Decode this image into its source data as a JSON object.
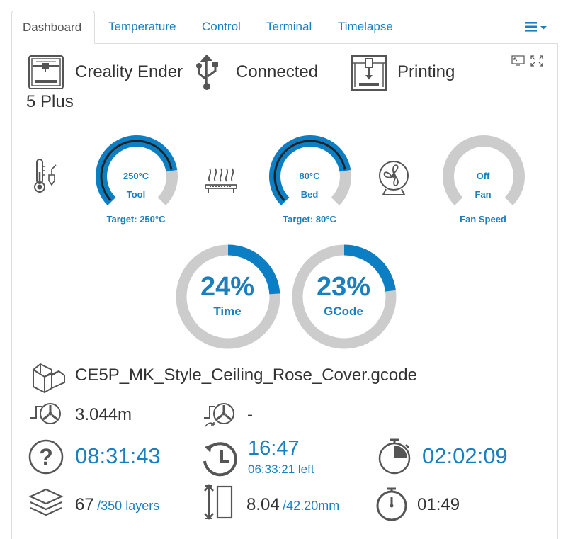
{
  "tabs": [
    {
      "label": "Dashboard",
      "active": true
    },
    {
      "label": "Temperature"
    },
    {
      "label": "Control"
    },
    {
      "label": "Terminal"
    },
    {
      "label": "Timelapse"
    }
  ],
  "printer": {
    "name": "Creality Ender 5 Plus",
    "name_line1": "Creality Ender",
    "name_line2": "5 Plus",
    "connection": "Connected",
    "state": "Printing"
  },
  "gauges": {
    "tool": {
      "value": "250°C",
      "label": "Tool",
      "target": "Target: 250°C",
      "fraction": 1.0
    },
    "bed": {
      "value": "80°C",
      "label": "Bed",
      "target": "Target: 80°C",
      "fraction": 1.0
    },
    "fan": {
      "value": "Off",
      "label": "Fan",
      "target": "Fan Speed",
      "fraction": 0.0
    }
  },
  "progress": {
    "time": {
      "value": "24%",
      "label": "Time",
      "fraction": 0.24
    },
    "gcode": {
      "value": "23%",
      "label": "GCode",
      "fraction": 0.23
    }
  },
  "file": {
    "name": "CE5P_MK_Style_Ceiling_Rose_Cover.gcode"
  },
  "filament": {
    "used": "3.044m",
    "remaining": "-"
  },
  "times": {
    "estimated": "08:31:43",
    "eta": "16:47",
    "eta_left": "06:33:21 left",
    "elapsed": "02:02:09",
    "layer_time": "01:49"
  },
  "layers": {
    "current": "67",
    "total": "/350 layers"
  },
  "height": {
    "current": "8.04",
    "total": "/42.20mm"
  },
  "colors": {
    "accent": "#0c7fc4",
    "track": "#cccccc",
    "dark": "#222222"
  }
}
